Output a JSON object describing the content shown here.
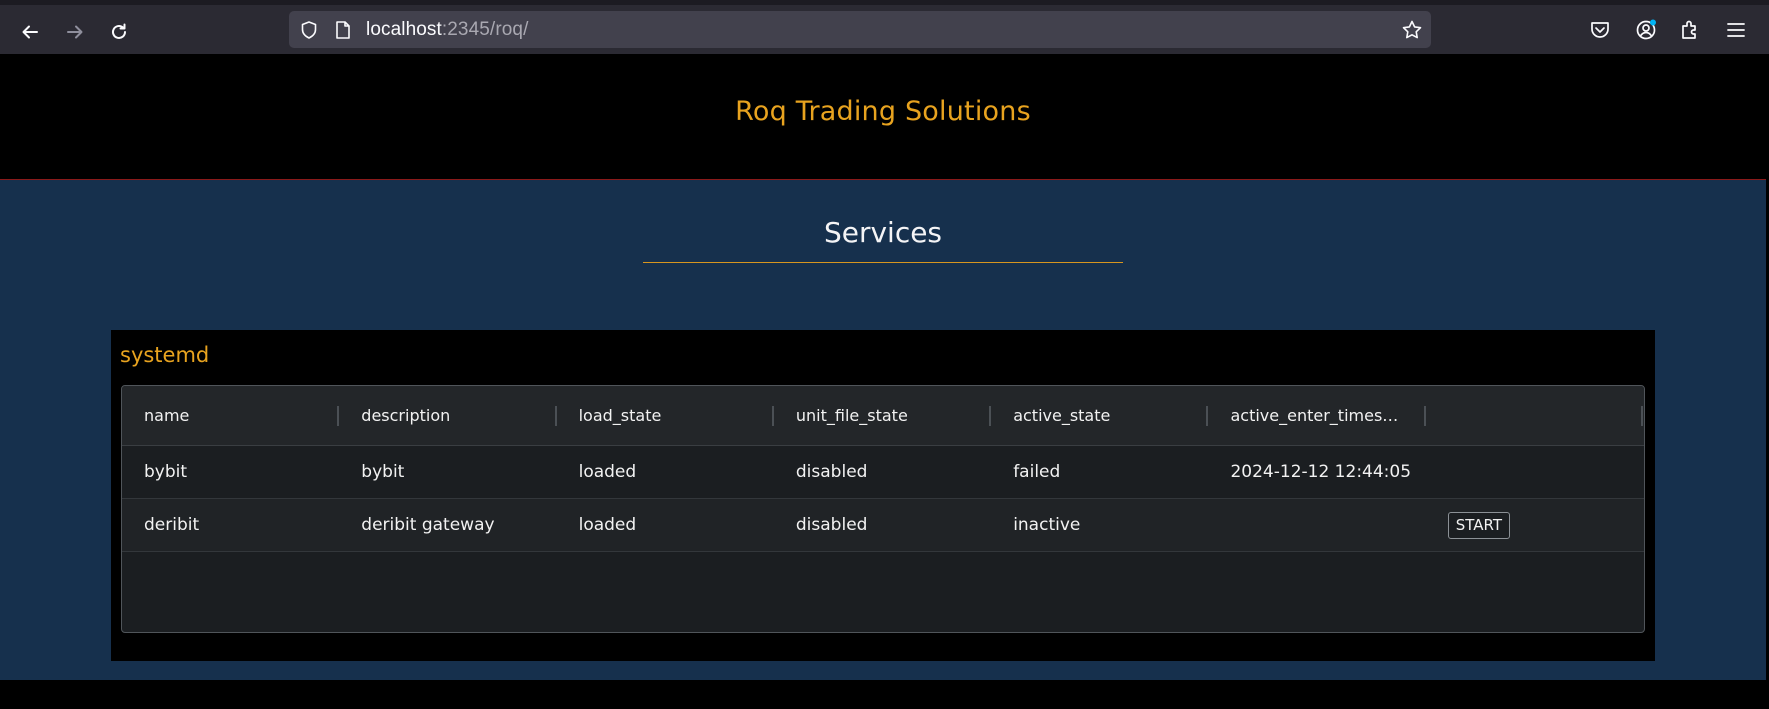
{
  "browser": {
    "url_host": "localhost",
    "url_rest": ":2345/roq/"
  },
  "app": {
    "brand": "Roq Trading Solutions",
    "section_title": "Services",
    "panel_title": "systemd"
  },
  "table": {
    "columns": [
      "name",
      "description",
      "load_state",
      "unit_file_state",
      "active_state",
      "active_enter_timesta…",
      ""
    ],
    "rows": [
      {
        "name": "bybit",
        "description": "bybit",
        "load_state": "loaded",
        "unit_file_state": "disabled",
        "active_state": "failed",
        "active_enter_timestamp": "2024-12-12 12:44:05",
        "action": ""
      },
      {
        "name": "deribit",
        "description": "deribit gateway",
        "load_state": "loaded",
        "unit_file_state": "disabled",
        "active_state": "inactive",
        "active_enter_timestamp": "",
        "action": "START"
      }
    ]
  },
  "colors": {
    "brand": "#e8a31f",
    "content_bg": "#16304d",
    "panel_bg": "#000000"
  }
}
